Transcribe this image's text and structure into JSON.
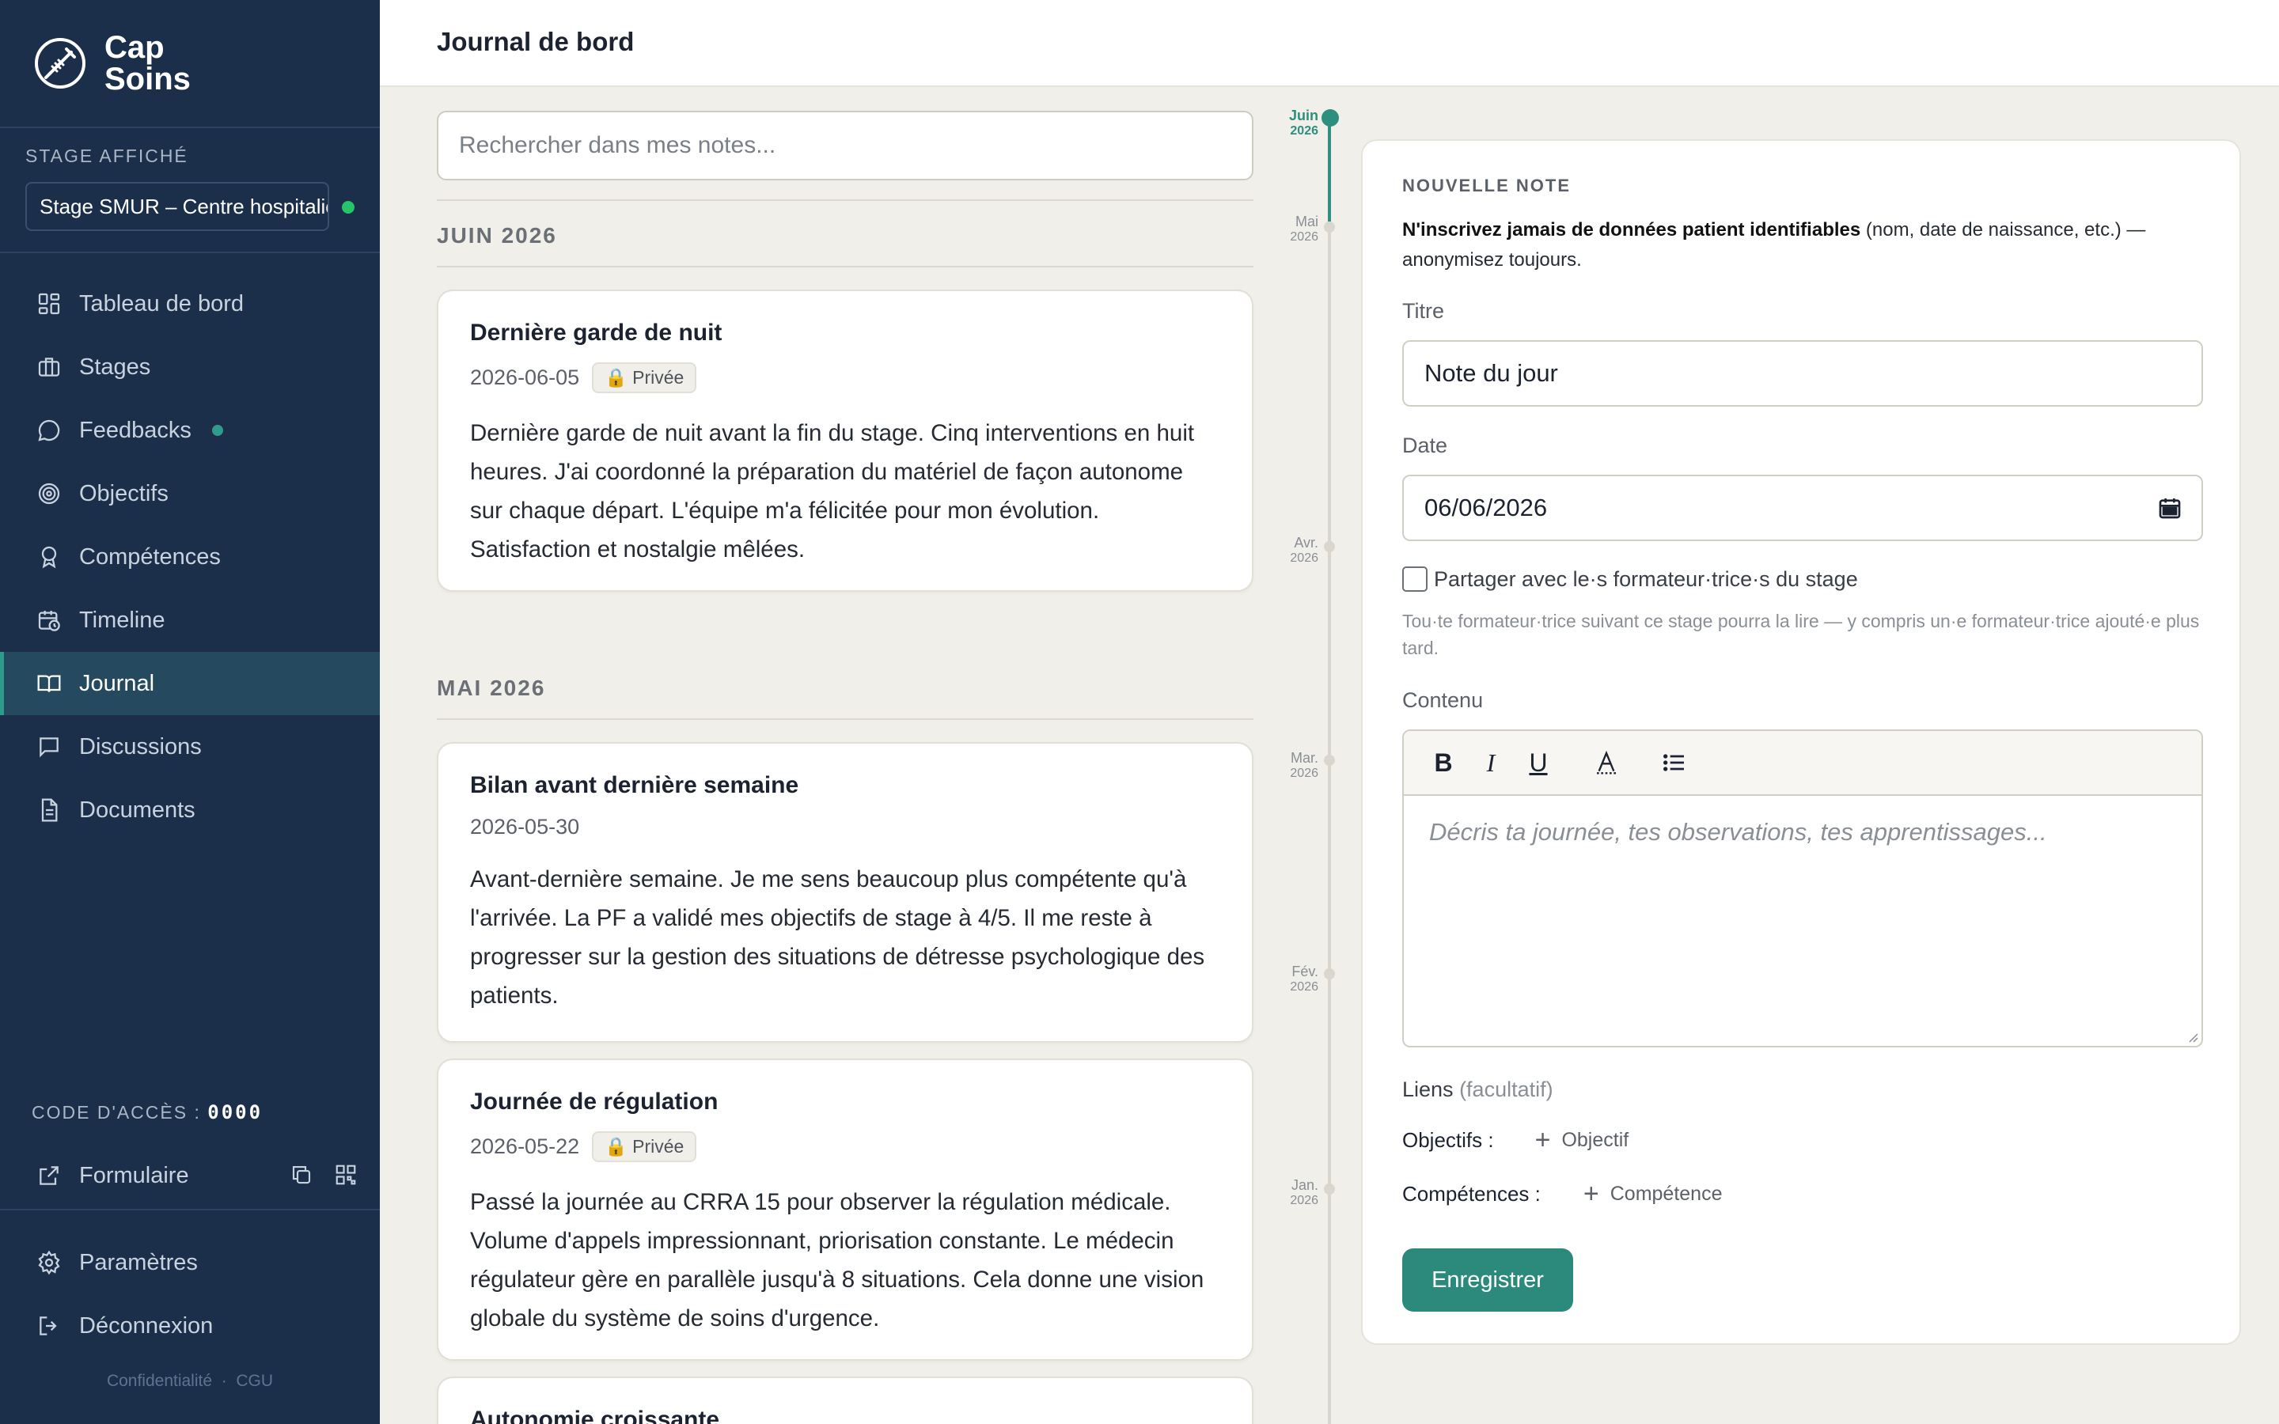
{
  "brand": {
    "line1": "Cap",
    "line2": "Soins",
    "logo_icon": "stethoscope-compass-icon"
  },
  "sidebar": {
    "stage_label": "STAGE AFFICHÉ",
    "stage_value": "Stage SMUR – Centre hospitalier",
    "items": [
      {
        "label": "Tableau de bord",
        "icon": "dashboard-icon"
      },
      {
        "label": "Stages",
        "icon": "briefcase-icon"
      },
      {
        "label": "Feedbacks",
        "icon": "chat-bubble-icon",
        "badge": true
      },
      {
        "label": "Objectifs",
        "icon": "target-icon"
      },
      {
        "label": "Compétences",
        "icon": "award-icon"
      },
      {
        "label": "Timeline",
        "icon": "calendar-clock-icon"
      },
      {
        "label": "Journal",
        "icon": "open-book-icon",
        "active": true
      },
      {
        "label": "Discussions",
        "icon": "message-square-icon"
      },
      {
        "label": "Documents",
        "icon": "document-icon"
      }
    ],
    "access_label": "CODE D'ACCÈS :",
    "access_code": "0000",
    "form_label": "Formulaire",
    "settings_label": "Paramètres",
    "logout_label": "Déconnexion",
    "privacy_label": "Confidentialité",
    "legal_sep": "·",
    "terms_label": "CGU"
  },
  "header": {
    "title": "Journal de bord"
  },
  "search": {
    "placeholder": "Rechercher dans mes notes..."
  },
  "months": [
    {
      "label": "JUIN 2026"
    },
    {
      "label": "MAI 2026"
    }
  ],
  "notes": [
    {
      "title": "Dernière garde de nuit",
      "date": "2026-06-05",
      "badge": "🔒 Privée",
      "body": "Dernière garde de nuit avant la fin du stage. Cinq interventions en huit heures. J'ai coordonné la préparation du matériel de façon autonome sur chaque départ. L'équipe m'a félicitée pour mon évolution. Satisfaction et nostalgie mêlées."
    },
    {
      "title": "Bilan avant dernière semaine",
      "date": "2026-05-30",
      "body": "Avant-dernière semaine. Je me sens beaucoup plus compétente qu'à l'arrivée. La PF a validé mes objectifs de stage à 4/5. Il me reste à progresser sur la gestion des situations de détresse psychologique des patients."
    },
    {
      "title": "Journée de régulation",
      "date": "2026-05-22",
      "badge": "🔒 Privée",
      "body": "Passé la journée au CRRA 15 pour observer la régulation médicale. Volume d'appels impressionnant, priorisation constante. Le médecin régulateur gère en parallèle jusqu'à 8 situations. Cela donne une vision globale du système de soins d'urgence."
    },
    {
      "title": "Autonomie croissante"
    }
  ],
  "timeline": [
    {
      "month": "Juin",
      "year": "2026",
      "active": true
    },
    {
      "month": "Mai",
      "year": "2026"
    },
    {
      "month": "Avr.",
      "year": "2026"
    },
    {
      "month": "Mar.",
      "year": "2026"
    },
    {
      "month": "Fév.",
      "year": "2026"
    },
    {
      "month": "Jan.",
      "year": "2026"
    }
  ],
  "new_note": {
    "section_label": "NOUVELLE NOTE",
    "warning_bold": "N'inscrivez jamais de données patient identifiables",
    "warning_rest": " (nom, date de naissance, etc.) — anonymisez toujours.",
    "title_label": "Titre",
    "title_value": "Note du jour",
    "date_label": "Date",
    "date_value": "06/06/2026",
    "share_label": "Partager avec le·s formateur·trice·s du stage",
    "share_checked": false,
    "share_help": "Tou·te formateur·trice suivant ce stage pourra la lire — y compris un·e formateur·trice ajouté·e plus tard.",
    "content_label": "Contenu",
    "content_placeholder": "Décris ta journée, tes observations, tes apprentissages...",
    "toolbar": {
      "bold": "B",
      "italic": "I",
      "underline": "U"
    },
    "links_label": "Liens",
    "links_optional": "(facultatif)",
    "objectives_label": "Objectifs :",
    "add_objective": "Objectif",
    "skills_label": "Compétences :",
    "add_skill": "Compétence",
    "save_label": "Enregistrer"
  },
  "colors": {
    "sidebar_bg": "#1c2f4a",
    "accent": "#2b8a7b",
    "active_nav": "#254a60",
    "status_dot": "#27c46a"
  }
}
